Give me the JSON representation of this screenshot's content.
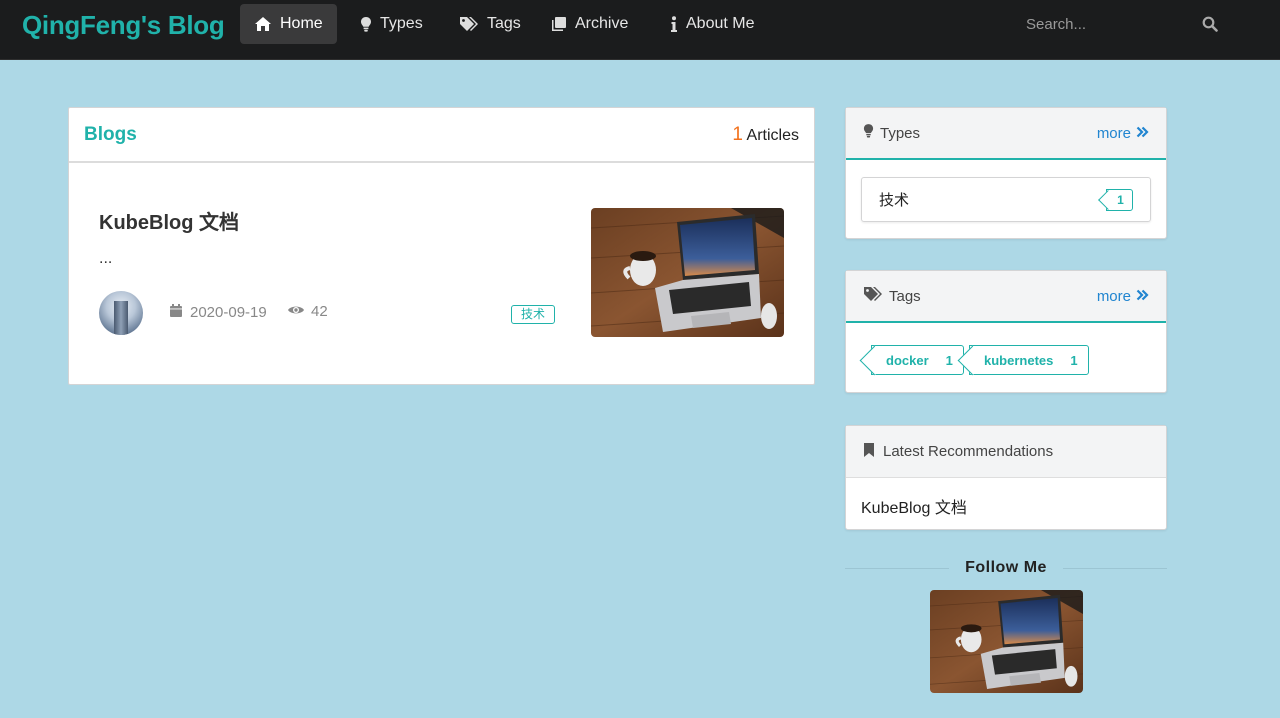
{
  "nav": {
    "brand": "QingFeng's Blog",
    "items": [
      {
        "label": "Home",
        "icon": "home-icon",
        "active": true
      },
      {
        "label": "Types",
        "icon": "lightbulb-icon"
      },
      {
        "label": "Tags",
        "icon": "tags-icon"
      },
      {
        "label": "Archive",
        "icon": "archive-icon"
      },
      {
        "label": "About Me",
        "icon": "info-icon"
      }
    ],
    "search_placeholder": "Search..."
  },
  "blogs": {
    "title": "Blogs",
    "count": "1",
    "count_label": "Articles",
    "posts": [
      {
        "title": "KubeBlog 文档",
        "excerpt": "...",
        "date": "2020-09-19",
        "views": "42",
        "type": "技术"
      }
    ]
  },
  "sidebar": {
    "types": {
      "title": "Types",
      "more": "more",
      "items": [
        {
          "name": "技术",
          "count": "1"
        }
      ]
    },
    "tags": {
      "title": "Tags",
      "more": "more",
      "items": [
        {
          "name": "docker",
          "count": "1"
        },
        {
          "name": "kubernetes",
          "count": "1"
        }
      ]
    },
    "latest": {
      "title": "Latest Recommendations",
      "items": [
        "KubeBlog 文档"
      ]
    }
  },
  "follow": {
    "title": "Follow Me"
  },
  "colors": {
    "accent": "#20b2aa",
    "page_background": "#add8e6",
    "navbar": "#1b1c1d",
    "link": "#2185d0",
    "count_highlight": "#f2711c"
  }
}
